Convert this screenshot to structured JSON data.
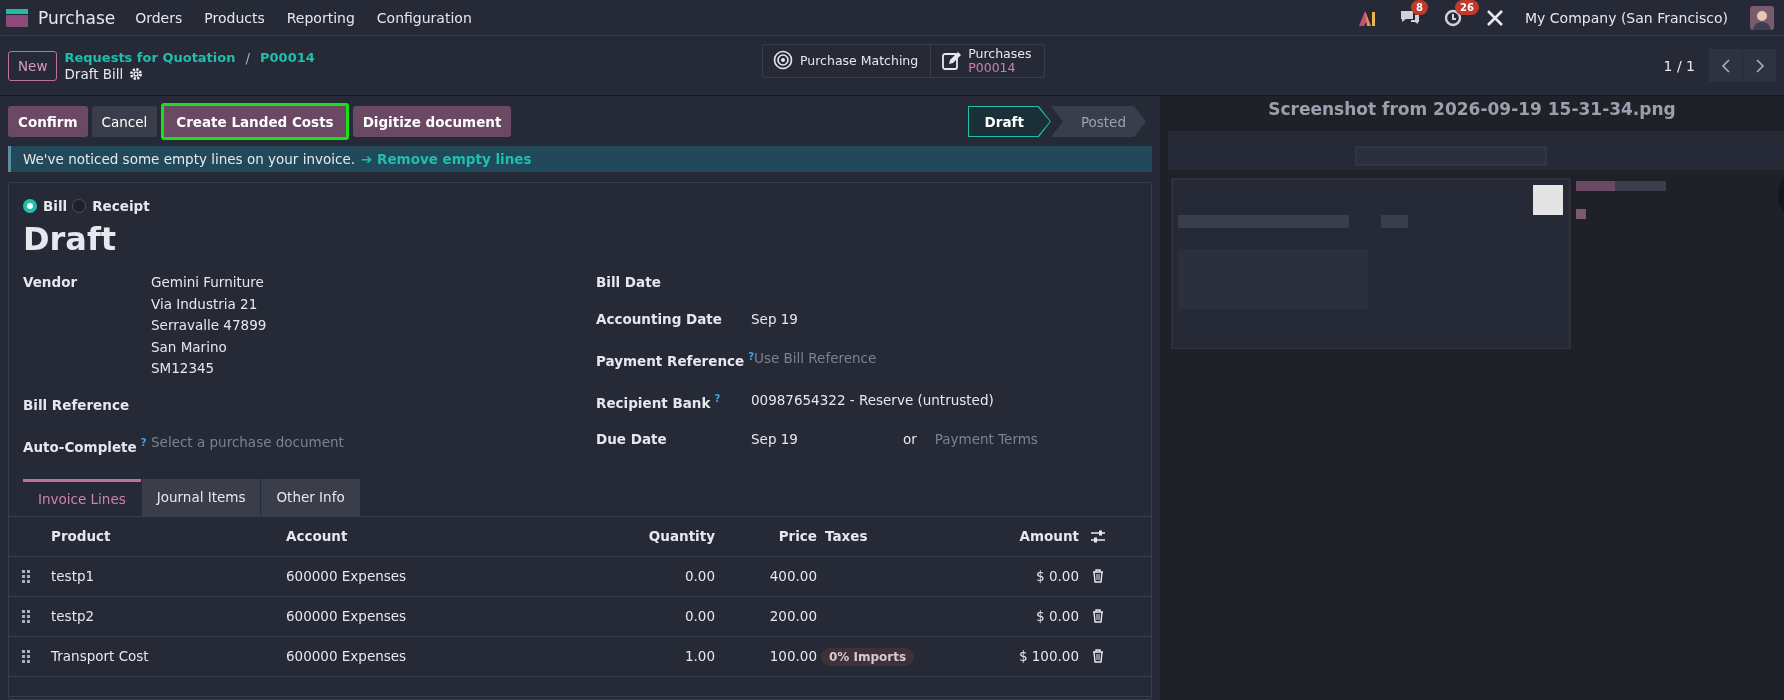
{
  "navbar": {
    "app": "Purchase",
    "menu": [
      "Orders",
      "Products",
      "Reporting",
      "Configuration"
    ],
    "messages_count": "8",
    "activities_count": "26",
    "company": "My Company (San Francisco)"
  },
  "control_panel": {
    "new_button": "New",
    "breadcrumbs": [
      "Requests for Quotation",
      "P00014"
    ],
    "separator": "/",
    "title": "Draft Bill",
    "smart_buttons": [
      {
        "label": "Purchase Matching",
        "kind": "matching"
      },
      {
        "label": "Purchases",
        "value": "P00014",
        "kind": "edit"
      }
    ],
    "pager": "1 / 1"
  },
  "actions": [
    {
      "label": "Confirm",
      "kind": "primary",
      "highlighted": false
    },
    {
      "label": "Cancel",
      "kind": "secondary",
      "highlighted": false
    },
    {
      "label": "Create Landed Costs",
      "kind": "primary",
      "highlighted": true
    },
    {
      "label": "Digitize document",
      "kind": "primary",
      "highlighted": false
    }
  ],
  "statusbar": [
    {
      "label": "Draft",
      "selected": true
    },
    {
      "label": "Posted",
      "selected": false
    }
  ],
  "alert": {
    "text": "We've noticed some empty lines on your invoice.",
    "link": "➔ Remove empty lines"
  },
  "form": {
    "types": [
      {
        "label": "Bill",
        "selected": true
      },
      {
        "label": "Receipt",
        "selected": false
      }
    ],
    "title": "Draft",
    "left_fields": [
      {
        "label": "Vendor",
        "lines": [
          "Gemini Furniture",
          "Via Industria 21",
          "Serravalle 47899",
          "San Marino",
          "SM12345"
        ]
      },
      {
        "label": "Bill Reference"
      },
      {
        "label": "Auto-Complete",
        "help": "?",
        "placeholder": "Select a purchase document"
      }
    ],
    "right_fields": [
      {
        "label": "Bill Date"
      },
      {
        "label": "Accounting Date",
        "lines": [
          "Sep 19"
        ]
      },
      {
        "label": "Payment Reference",
        "help": "?",
        "placeholder": "Use Bill Reference"
      },
      {
        "label": "Recipient Bank",
        "help": "?",
        "lines": [
          "00987654322 - Reserve (untrusted)"
        ]
      },
      {
        "label": "Due Date",
        "lines": [
          "Sep 19"
        ],
        "or": "or",
        "placeholder": "Payment Terms"
      }
    ]
  },
  "tabs": [
    {
      "label": "Invoice Lines",
      "selected": true
    },
    {
      "label": "Journal Items",
      "selected": false
    },
    {
      "label": "Other Info",
      "selected": false
    }
  ],
  "table": {
    "columns": [
      {
        "label": "Product"
      },
      {
        "label": "Account"
      },
      {
        "label": "Quantity"
      },
      {
        "label": "Price"
      },
      {
        "label": "Taxes"
      },
      {
        "label": "Amount"
      }
    ],
    "rows": [
      {
        "product": "testp1",
        "account": "600000 Expenses",
        "quantity": "0.00",
        "price": "400.00",
        "amount": "$ 0.00"
      },
      {
        "product": "testp2",
        "account": "600000 Expenses",
        "quantity": "0.00",
        "price": "200.00",
        "amount": "$ 0.00"
      },
      {
        "product": "Transport Cost",
        "account": "600000 Expenses",
        "quantity": "1.00",
        "price": "100.00",
        "taxes": "0% Imports",
        "amount": "$ 100.00"
      }
    ]
  },
  "preview": {
    "title": "Screenshot from 2026-09-19 15-31-34.png"
  }
}
